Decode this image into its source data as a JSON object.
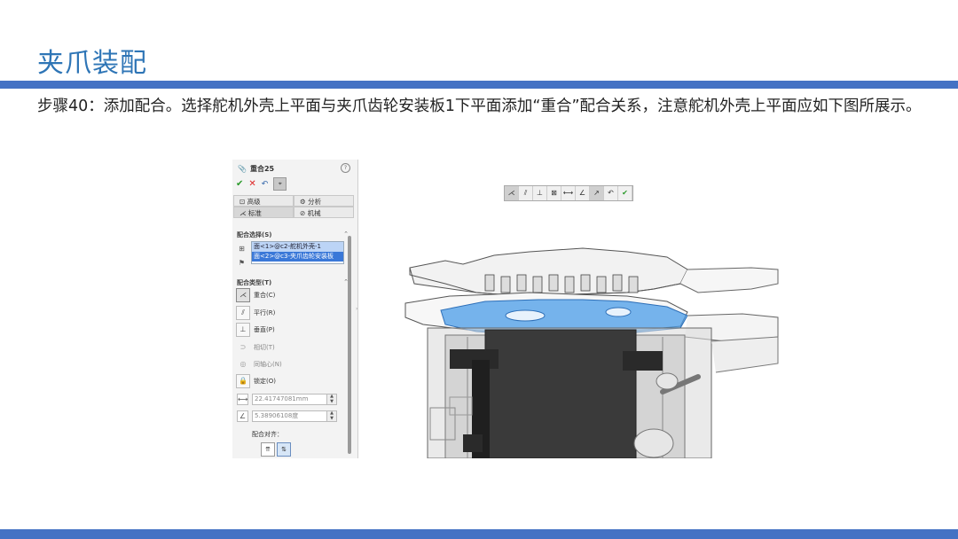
{
  "slide": {
    "title": "夹爪装配",
    "step_text": "步骤40：添加配合。选择舵机外壳上平面与夹爪齿轮安装板1下平面添加“重合”配合关系，注意舵机外壳上平面应如下图所展示。",
    "accent_color": "#4472c4",
    "title_color": "#2e75b6"
  },
  "panel": {
    "title": "重合25",
    "help": "?",
    "tabs": [
      {
        "label": "高级"
      },
      {
        "label": "分析"
      },
      {
        "label": "标准"
      },
      {
        "label": "机械"
      }
    ],
    "mate_selection": {
      "label": "配合选择(S)",
      "items": [
        "面<1>@c2-舵机外壳-1",
        "面<2>@c3-夹爪齿轮安装板"
      ]
    },
    "mate_types": {
      "label": "配合类型(T)",
      "items": [
        {
          "label": "重合(C)",
          "icon": "coincident-icon",
          "active": true
        },
        {
          "label": "平行(R)",
          "icon": "parallel-icon",
          "active": false
        },
        {
          "label": "垂直(P)",
          "icon": "perpendicular-icon",
          "active": false
        },
        {
          "label": "相切(T)",
          "icon": "tangent-icon",
          "active": false,
          "disabled": true
        },
        {
          "label": "同轴心(N)",
          "icon": "concentric-icon",
          "active": false,
          "disabled": true
        },
        {
          "label": "锁定(O)",
          "icon": "lock-icon",
          "active": false
        }
      ],
      "distance_value": "22.41747081mm",
      "angle_value": "5.38906108度"
    },
    "alignment_label": "配合对齐："
  },
  "viewport": {
    "toolbar_icons": [
      "coincident-icon",
      "parallel-icon",
      "perpendicular-icon",
      "lock-icon",
      "distance-icon",
      "angle-icon",
      "flip-icon",
      "undo-icon",
      "ok-icon"
    ]
  }
}
